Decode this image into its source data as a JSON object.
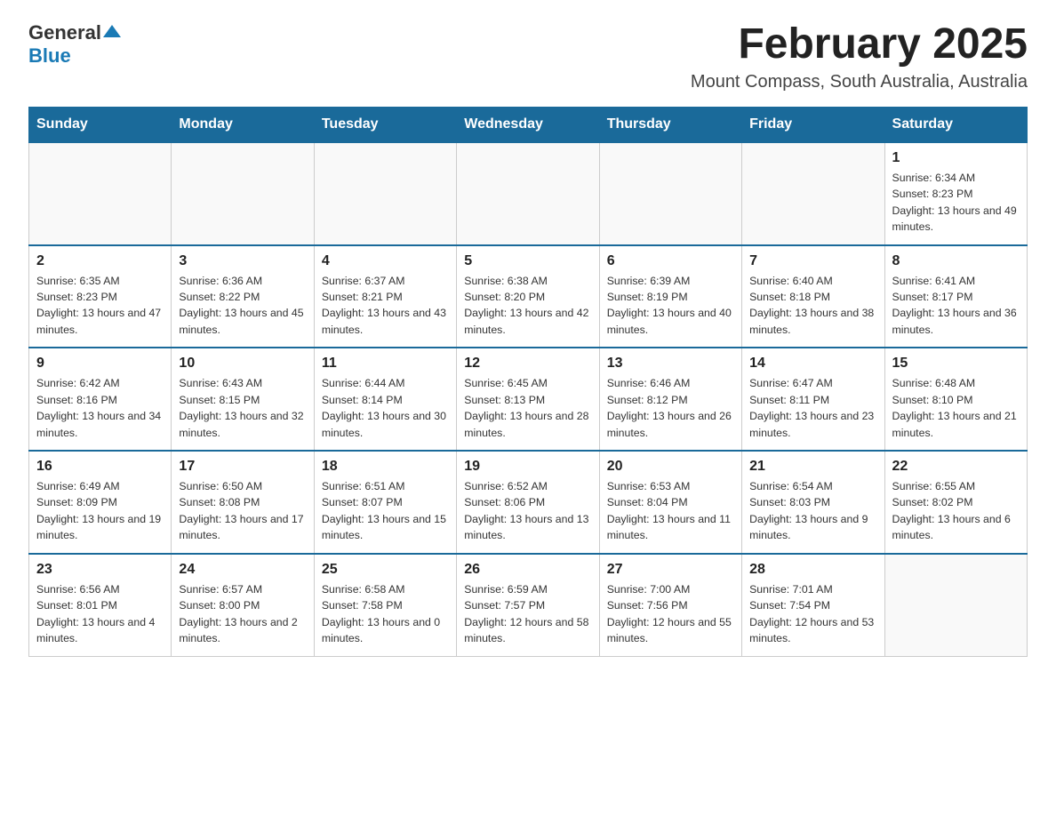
{
  "logo": {
    "general": "General",
    "blue": "Blue"
  },
  "title": "February 2025",
  "location": "Mount Compass, South Australia, Australia",
  "weekdays": [
    "Sunday",
    "Monday",
    "Tuesday",
    "Wednesday",
    "Thursday",
    "Friday",
    "Saturday"
  ],
  "weeks": [
    [
      {
        "day": "",
        "info": ""
      },
      {
        "day": "",
        "info": ""
      },
      {
        "day": "",
        "info": ""
      },
      {
        "day": "",
        "info": ""
      },
      {
        "day": "",
        "info": ""
      },
      {
        "day": "",
        "info": ""
      },
      {
        "day": "1",
        "info": "Sunrise: 6:34 AM\nSunset: 8:23 PM\nDaylight: 13 hours and 49 minutes."
      }
    ],
    [
      {
        "day": "2",
        "info": "Sunrise: 6:35 AM\nSunset: 8:23 PM\nDaylight: 13 hours and 47 minutes."
      },
      {
        "day": "3",
        "info": "Sunrise: 6:36 AM\nSunset: 8:22 PM\nDaylight: 13 hours and 45 minutes."
      },
      {
        "day": "4",
        "info": "Sunrise: 6:37 AM\nSunset: 8:21 PM\nDaylight: 13 hours and 43 minutes."
      },
      {
        "day": "5",
        "info": "Sunrise: 6:38 AM\nSunset: 8:20 PM\nDaylight: 13 hours and 42 minutes."
      },
      {
        "day": "6",
        "info": "Sunrise: 6:39 AM\nSunset: 8:19 PM\nDaylight: 13 hours and 40 minutes."
      },
      {
        "day": "7",
        "info": "Sunrise: 6:40 AM\nSunset: 8:18 PM\nDaylight: 13 hours and 38 minutes."
      },
      {
        "day": "8",
        "info": "Sunrise: 6:41 AM\nSunset: 8:17 PM\nDaylight: 13 hours and 36 minutes."
      }
    ],
    [
      {
        "day": "9",
        "info": "Sunrise: 6:42 AM\nSunset: 8:16 PM\nDaylight: 13 hours and 34 minutes."
      },
      {
        "day": "10",
        "info": "Sunrise: 6:43 AM\nSunset: 8:15 PM\nDaylight: 13 hours and 32 minutes."
      },
      {
        "day": "11",
        "info": "Sunrise: 6:44 AM\nSunset: 8:14 PM\nDaylight: 13 hours and 30 minutes."
      },
      {
        "day": "12",
        "info": "Sunrise: 6:45 AM\nSunset: 8:13 PM\nDaylight: 13 hours and 28 minutes."
      },
      {
        "day": "13",
        "info": "Sunrise: 6:46 AM\nSunset: 8:12 PM\nDaylight: 13 hours and 26 minutes."
      },
      {
        "day": "14",
        "info": "Sunrise: 6:47 AM\nSunset: 8:11 PM\nDaylight: 13 hours and 23 minutes."
      },
      {
        "day": "15",
        "info": "Sunrise: 6:48 AM\nSunset: 8:10 PM\nDaylight: 13 hours and 21 minutes."
      }
    ],
    [
      {
        "day": "16",
        "info": "Sunrise: 6:49 AM\nSunset: 8:09 PM\nDaylight: 13 hours and 19 minutes."
      },
      {
        "day": "17",
        "info": "Sunrise: 6:50 AM\nSunset: 8:08 PM\nDaylight: 13 hours and 17 minutes."
      },
      {
        "day": "18",
        "info": "Sunrise: 6:51 AM\nSunset: 8:07 PM\nDaylight: 13 hours and 15 minutes."
      },
      {
        "day": "19",
        "info": "Sunrise: 6:52 AM\nSunset: 8:06 PM\nDaylight: 13 hours and 13 minutes."
      },
      {
        "day": "20",
        "info": "Sunrise: 6:53 AM\nSunset: 8:04 PM\nDaylight: 13 hours and 11 minutes."
      },
      {
        "day": "21",
        "info": "Sunrise: 6:54 AM\nSunset: 8:03 PM\nDaylight: 13 hours and 9 minutes."
      },
      {
        "day": "22",
        "info": "Sunrise: 6:55 AM\nSunset: 8:02 PM\nDaylight: 13 hours and 6 minutes."
      }
    ],
    [
      {
        "day": "23",
        "info": "Sunrise: 6:56 AM\nSunset: 8:01 PM\nDaylight: 13 hours and 4 minutes."
      },
      {
        "day": "24",
        "info": "Sunrise: 6:57 AM\nSunset: 8:00 PM\nDaylight: 13 hours and 2 minutes."
      },
      {
        "day": "25",
        "info": "Sunrise: 6:58 AM\nSunset: 7:58 PM\nDaylight: 13 hours and 0 minutes."
      },
      {
        "day": "26",
        "info": "Sunrise: 6:59 AM\nSunset: 7:57 PM\nDaylight: 12 hours and 58 minutes."
      },
      {
        "day": "27",
        "info": "Sunrise: 7:00 AM\nSunset: 7:56 PM\nDaylight: 12 hours and 55 minutes."
      },
      {
        "day": "28",
        "info": "Sunrise: 7:01 AM\nSunset: 7:54 PM\nDaylight: 12 hours and 53 minutes."
      },
      {
        "day": "",
        "info": ""
      }
    ]
  ]
}
